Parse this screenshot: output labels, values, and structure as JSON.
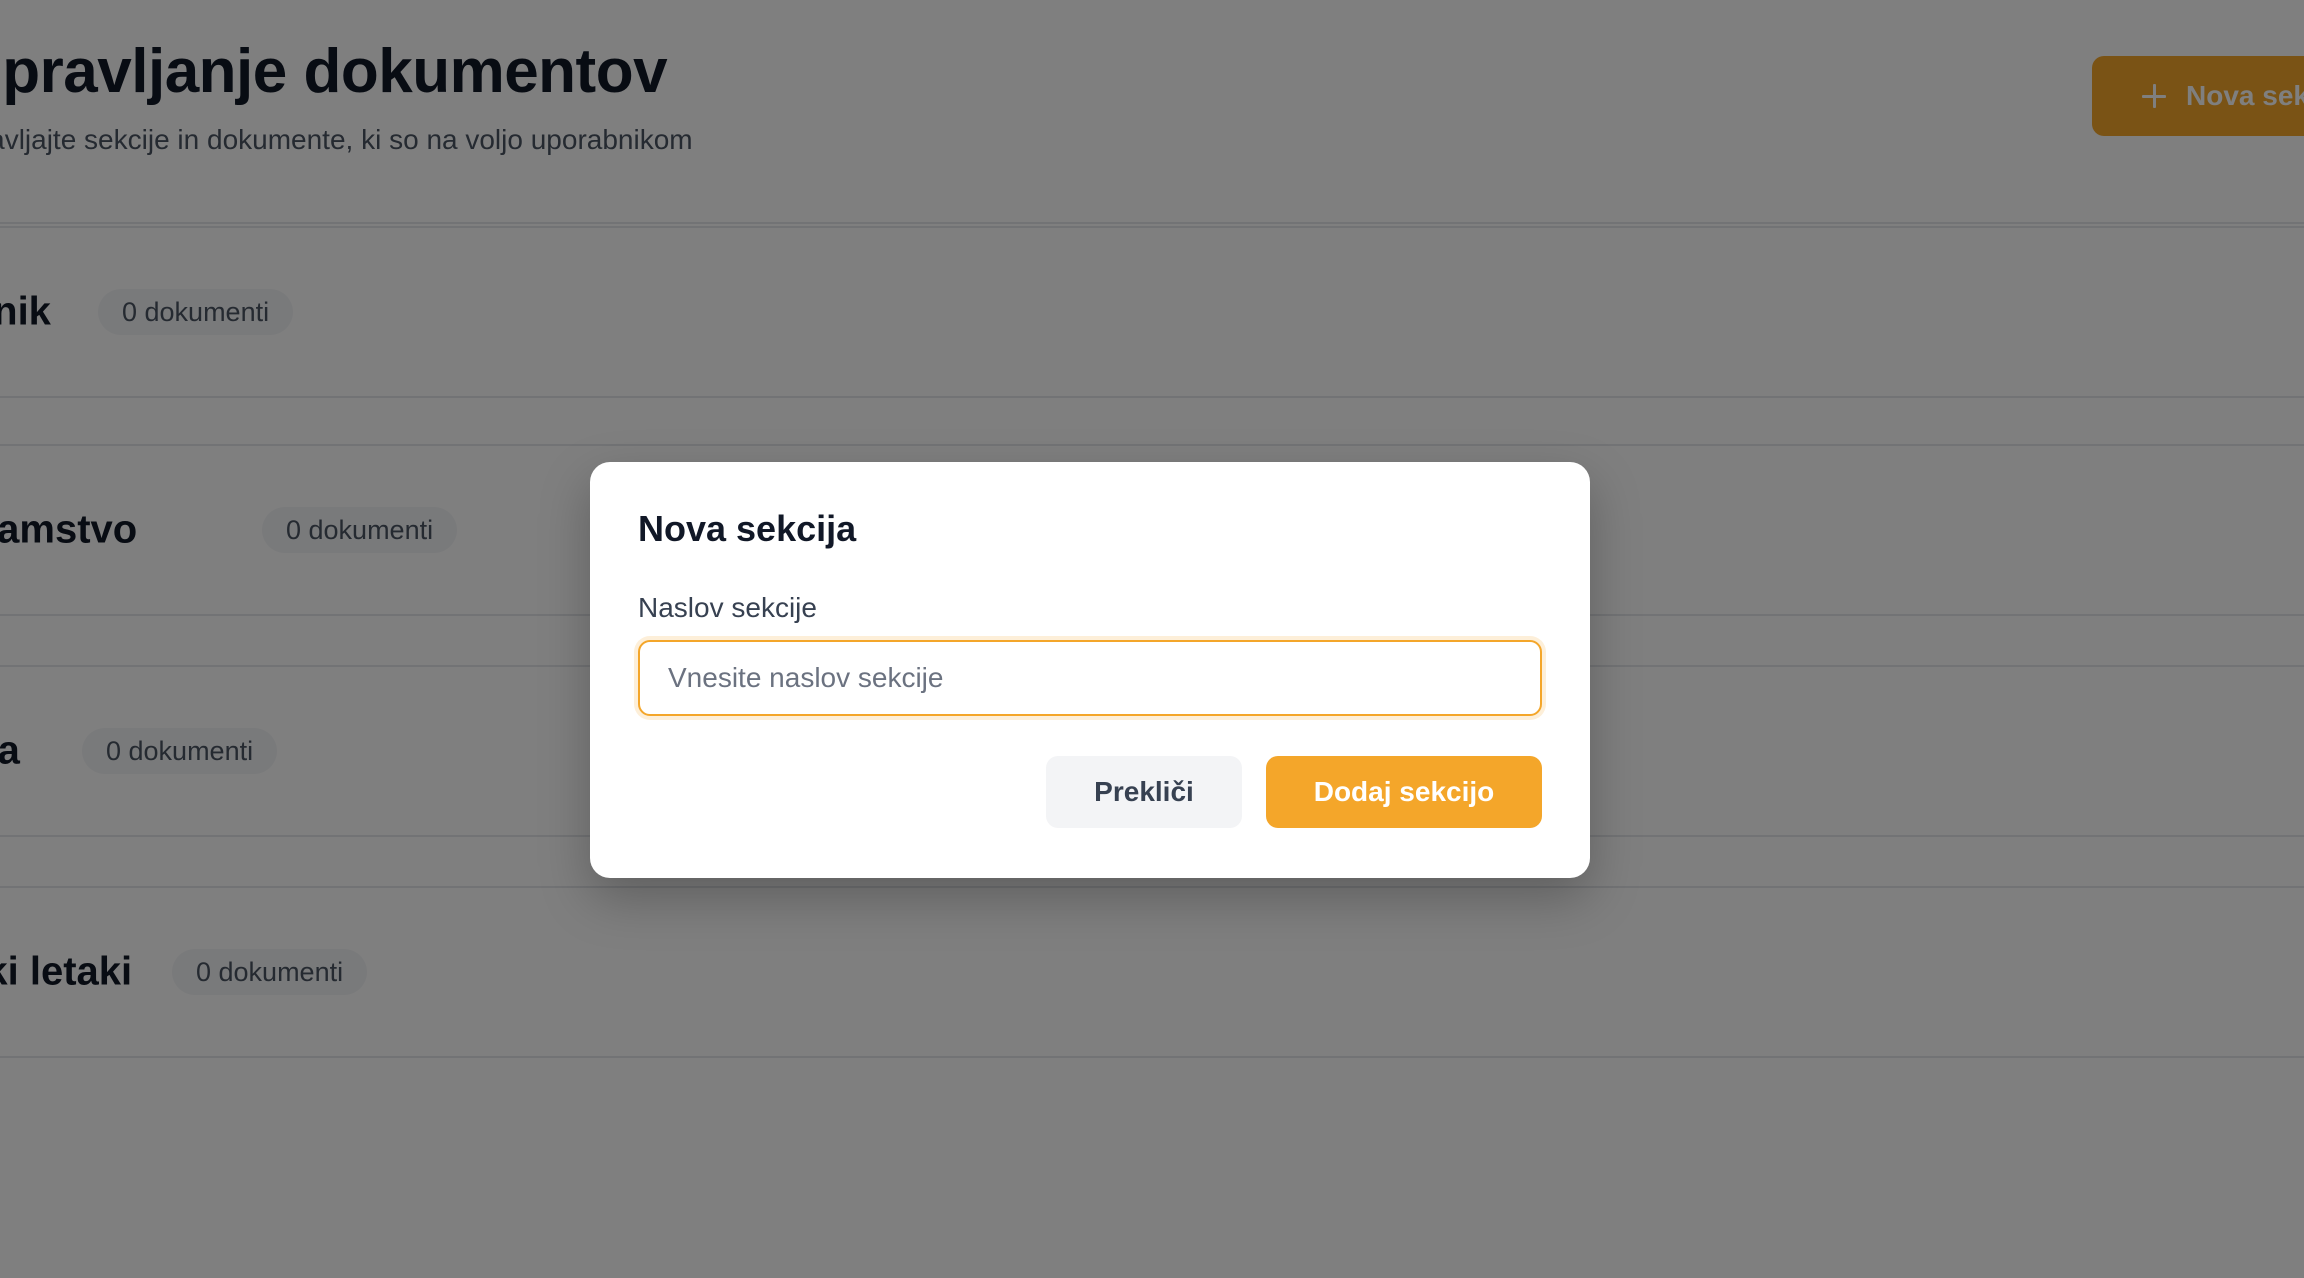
{
  "page": {
    "title": "Upravljanje dokumentov",
    "subtitle": "Upravljajte sekcije in dokumente, ki so na voljo uporabnikom",
    "new_section_label": "Nova sekcija"
  },
  "sections": [
    {
      "title": "Cenik",
      "badge": "0 dokumenti"
    },
    {
      "title": "Avtomobilno jamstvo",
      "badge": "0 dokumenti"
    },
    {
      "title": "Akcija",
      "badge": "0 dokumenti"
    },
    {
      "title": "Promocijski letaki",
      "badge": "0 dokumenti"
    }
  ],
  "modal": {
    "title": "Nova sekcija",
    "field_label": "Naslov sekcije",
    "input_placeholder": "Vnesite naslov sekcije",
    "input_value": "",
    "cancel_label": "Prekliči",
    "submit_label": "Dodaj sekcijo"
  },
  "colors": {
    "accent": "#f4a62a",
    "overlay": "rgba(0,0,0,0.5)"
  },
  "icons": {
    "new_section": "plus-icon"
  }
}
